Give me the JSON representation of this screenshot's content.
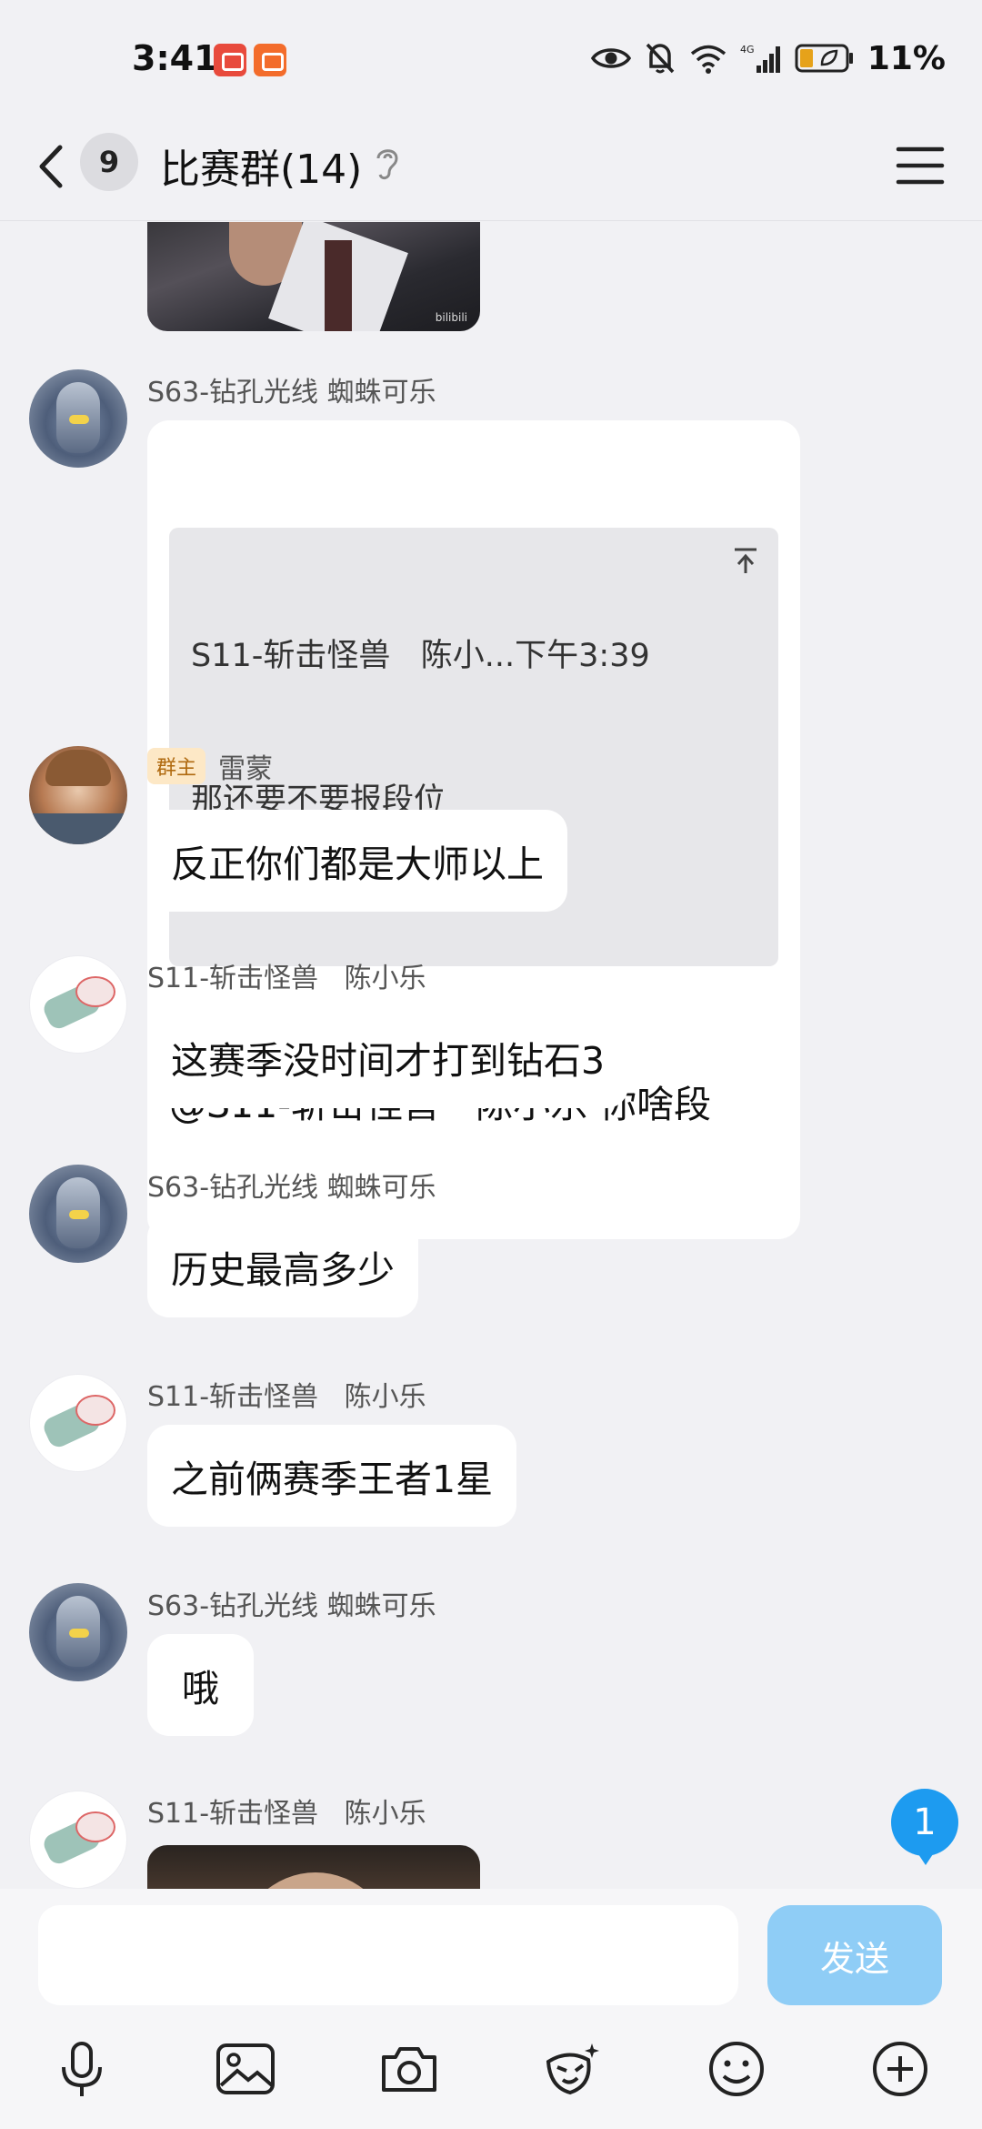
{
  "status_bar": {
    "time": "3:41",
    "battery": "11%",
    "network": "4G"
  },
  "header": {
    "unread_count": "9",
    "title": "比赛群(14)"
  },
  "messages": [
    {
      "sender": "S63-钻孔光线 蜘蛛可乐",
      "quote_head": "S11-斩击怪兽   陈小...下午3:39",
      "quote_body": "那还要不要报段位",
      "text": "@S11-斩击怪兽   陈小乐 你啥段"
    },
    {
      "badge": "群主",
      "sender": "雷蒙",
      "text": "反正你们都是大师以上"
    },
    {
      "sender": "S11-斩击怪兽   陈小乐",
      "text": "这赛季没时间才打到钻石3"
    },
    {
      "sender": "S63-钻孔光线 蜘蛛可乐",
      "text": "历史最高多少"
    },
    {
      "sender": "S11-斩击怪兽   陈小乐",
      "text": "之前俩赛季王者1星"
    },
    {
      "sender": "S63-钻孔光线 蜘蛛可乐",
      "text": "哦"
    },
    {
      "sender": "S11-斩击怪兽   陈小乐"
    }
  ],
  "new_message_count": "1",
  "input": {
    "value": "",
    "placeholder": "",
    "send_label": "发送"
  },
  "toolbar_icons": [
    "mic-icon",
    "image-icon",
    "camera-icon",
    "sticker-icon",
    "emoji-icon",
    "plus-icon"
  ],
  "colors": {
    "background": "#f1f1f4",
    "bubble": "#ffffff",
    "accent": "#1d9bf0",
    "send_disabled": "#8fcdf6",
    "owner_badge": "#fde8c6"
  }
}
